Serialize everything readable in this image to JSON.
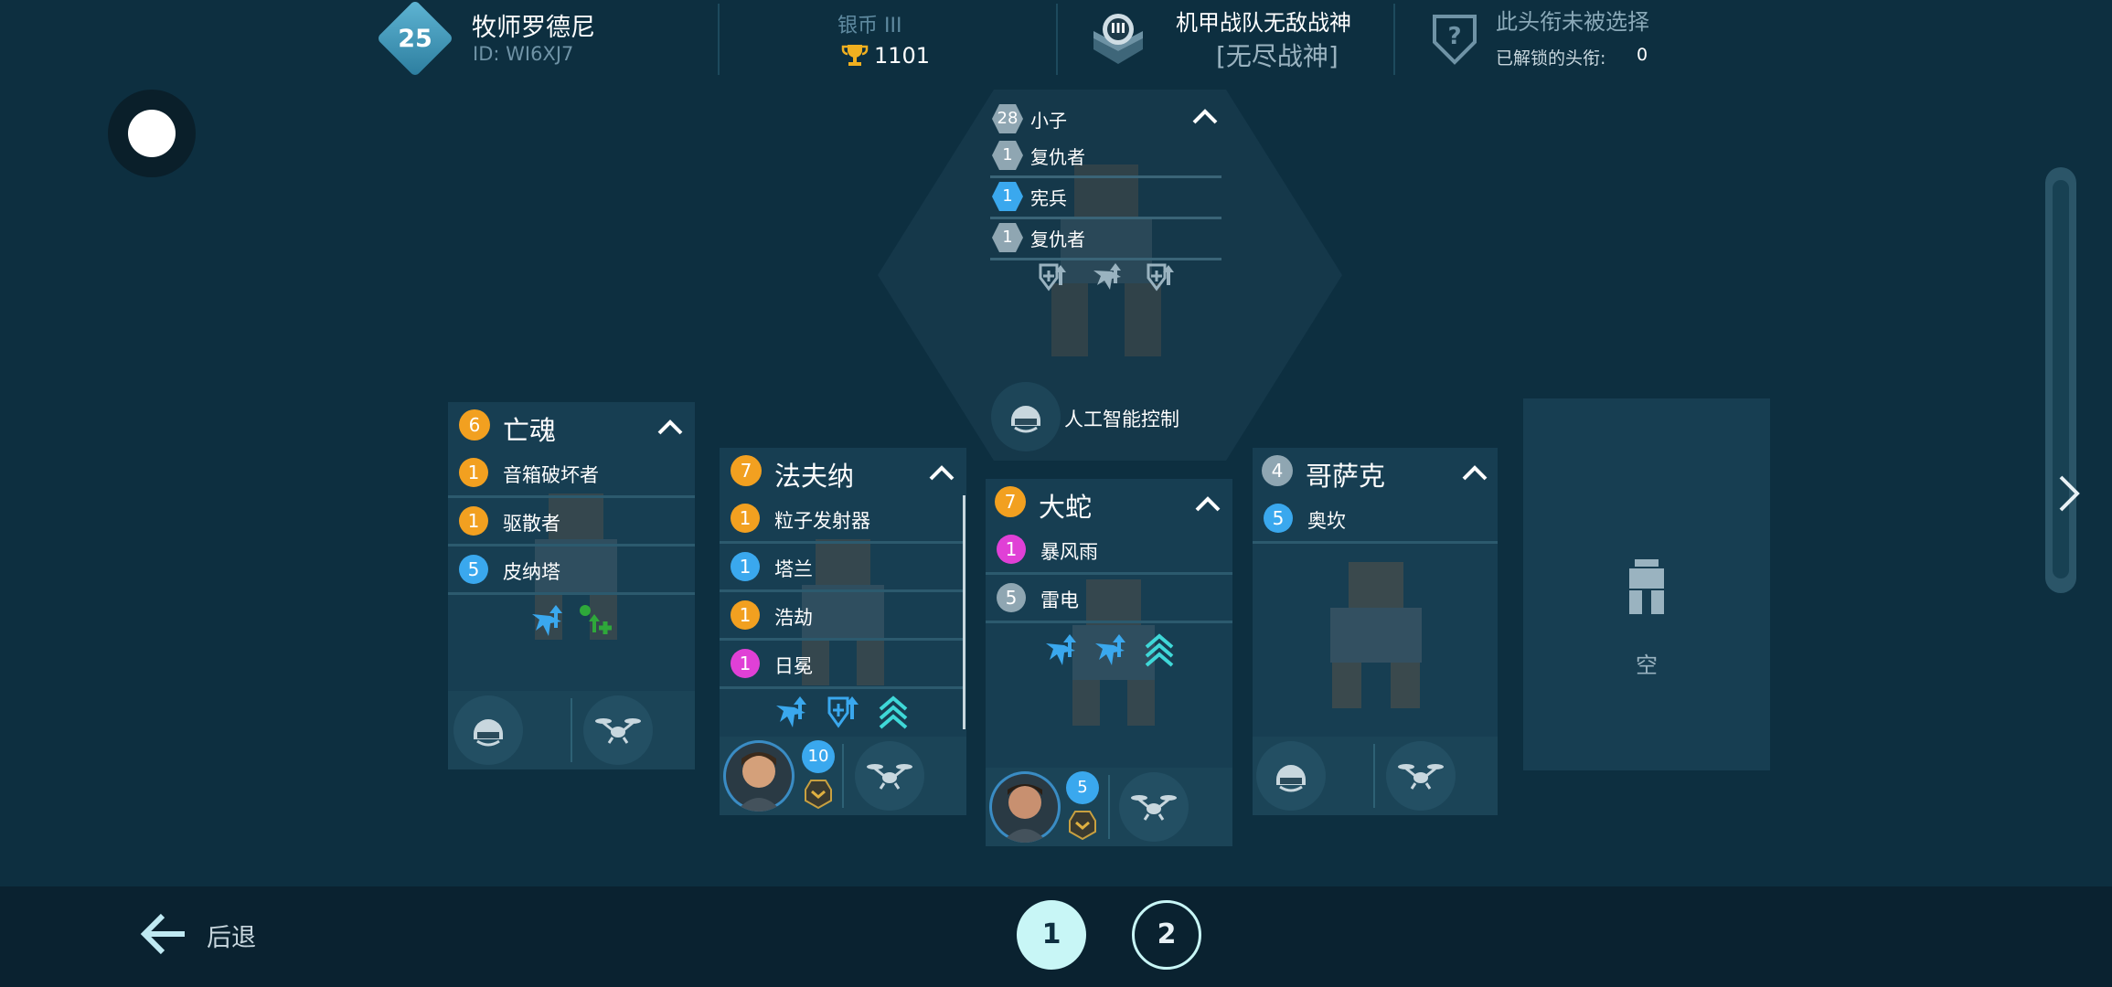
{
  "header": {
    "player": {
      "level": "25",
      "name": "牧师罗德尼",
      "id": "ID: WI6XJ7"
    },
    "league": {
      "name": "银币 III",
      "trophies": "1101"
    },
    "clan": {
      "badge": "III",
      "name": "机甲战队无敌战神",
      "tag": "[无尽战神]"
    },
    "title": {
      "status": "此头衔未被选择",
      "unlocked_label": "已解锁的头衔:",
      "unlocked_count": "0"
    }
  },
  "center_robot": {
    "level": "28",
    "name": "小子",
    "weapons": [
      {
        "level": "1",
        "name": "复仇者",
        "rarity": "grey"
      },
      {
        "level": "1",
        "name": "宪兵",
        "rarity": "blue"
      },
      {
        "level": "1",
        "name": "复仇者",
        "rarity": "grey"
      }
    ],
    "pilot_label": "人工智能控制"
  },
  "robots": [
    {
      "level": "6",
      "name": "亡魂",
      "rarity": "orange",
      "weapons": [
        {
          "level": "1",
          "name": "音箱破坏者",
          "rarity": "orange"
        },
        {
          "level": "1",
          "name": "驱散者",
          "rarity": "orange"
        },
        {
          "level": "5",
          "name": "皮纳塔",
          "rarity": "blue"
        }
      ]
    },
    {
      "level": "7",
      "name": "法夫纳",
      "rarity": "orange",
      "weapons": [
        {
          "level": "1",
          "name": "粒子发射器",
          "rarity": "orange"
        },
        {
          "level": "1",
          "name": "塔兰",
          "rarity": "blue"
        },
        {
          "level": "1",
          "name": "浩劫",
          "rarity": "orange"
        },
        {
          "level": "1",
          "name": "日冕",
          "rarity": "pink"
        }
      ],
      "pilot_level": "10"
    },
    {
      "level": "7",
      "name": "大蛇",
      "rarity": "orange",
      "weapons": [
        {
          "level": "1",
          "name": "暴风雨",
          "rarity": "pink"
        },
        {
          "level": "5",
          "name": "雷电",
          "rarity": "grey"
        }
      ],
      "pilot_level": "5"
    },
    {
      "level": "4",
      "name": "哥萨克",
      "rarity": "grey",
      "weapons": [
        {
          "level": "5",
          "name": "奥坎",
          "rarity": "blue"
        }
      ]
    }
  ],
  "empty_slot": {
    "label": "空"
  },
  "footer": {
    "back_label": "后退",
    "pages": [
      "1",
      "2"
    ],
    "active_page": "1"
  },
  "colors": {
    "background": "#0d2f40",
    "panel": "#173e52",
    "orange": "#f2a020",
    "blue": "#3aa8ee",
    "pink": "#e040d6",
    "grey": "#8fa6b2",
    "accent_cyan": "#3fd8d8",
    "active_page": "#c8f6f6"
  },
  "icons": [
    "lock-icon",
    "trophy-icon",
    "clan-emblem-icon",
    "question-shield-icon",
    "chevron-up-icon",
    "ai-helmet-icon",
    "drone-icon",
    "pilot-portrait-icon",
    "rank-chevron-icon",
    "robot-silhouette-icon",
    "back-arrow-icon",
    "chevron-right-icon",
    "ability-icon"
  ]
}
